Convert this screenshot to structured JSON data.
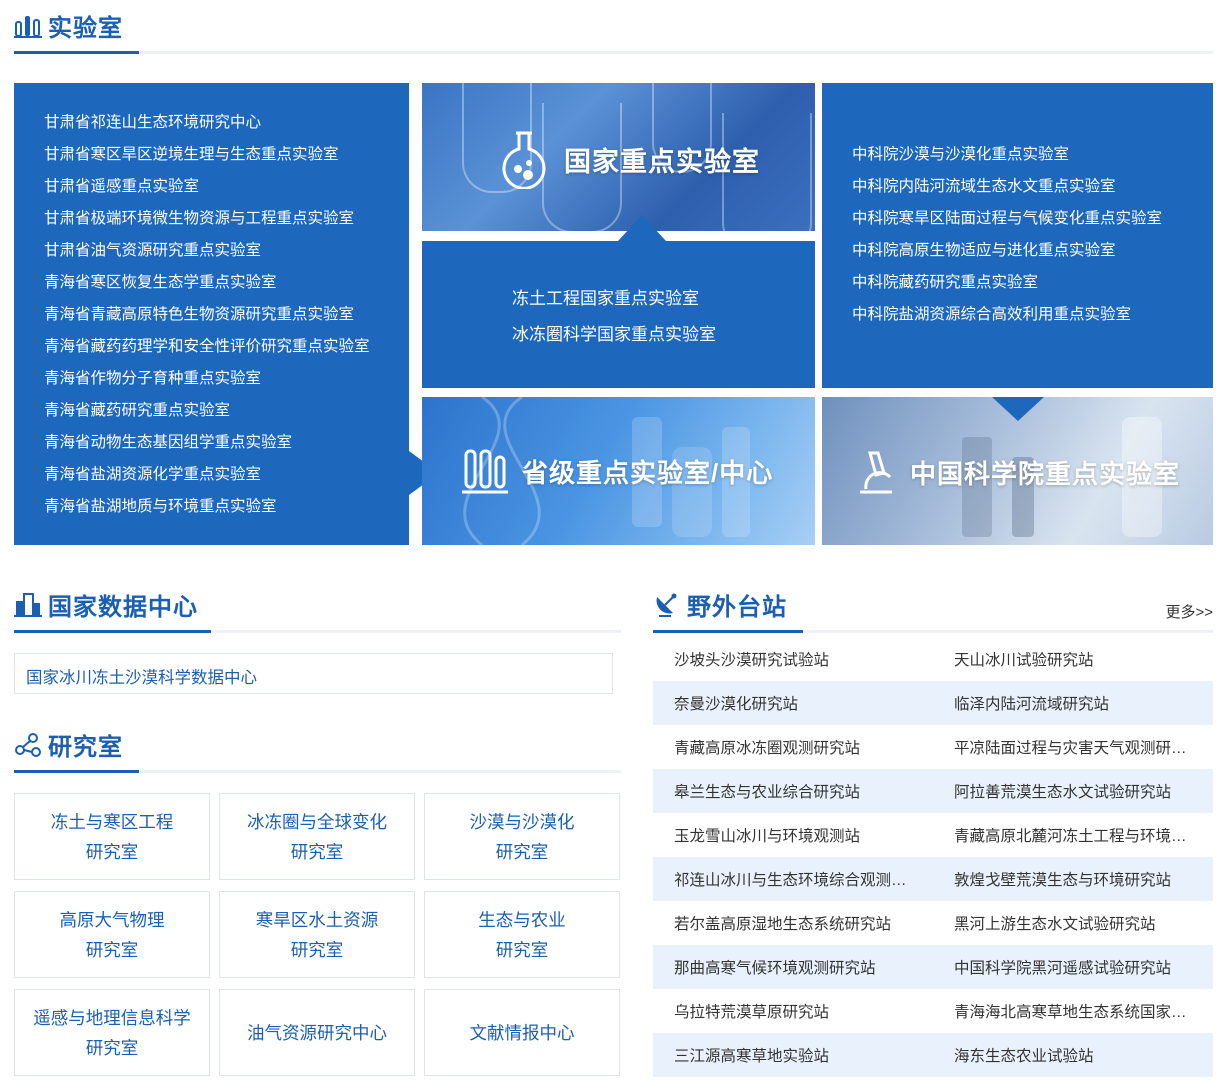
{
  "labs": {
    "title": "实验室",
    "provincial_list": [
      "甘肃省祁连山生态环境研究中心",
      "甘肃省寒区旱区逆境生理与生态重点实验室",
      "甘肃省遥感重点实验室",
      "甘肃省极端环境微生物资源与工程重点实验室",
      "甘肃省油气资源研究重点实验室",
      "青海省寒区恢复生态学重点实验室",
      "青海省青藏高原特色生物资源研究重点实验室",
      "青海省藏药药理学和安全性评价研究重点实验室",
      "青海省作物分子育种重点实验室",
      "青海省藏药研究重点实验室",
      "青海省动物生态基因组学重点实验室",
      "青海省盐湖资源化学重点实验室",
      "青海省盐湖地质与环境重点实验室"
    ],
    "national_title": "国家重点实验室",
    "national_list": [
      "冻土工程国家重点实验室",
      "冰冻圈科学国家重点实验室"
    ],
    "provincial_title": "省级重点实验室/中心",
    "cas_title": "中国科学院重点实验室",
    "cas_list": [
      "中科院沙漠与沙漠化重点实验室",
      "中科院内陆河流域生态水文重点实验室",
      "中科院寒旱区陆面过程与气候变化重点实验室",
      "中科院高原生物适应与进化重点实验室",
      "中科院藏药研究重点实验室",
      "中科院盐湖资源综合高效利用重点实验室"
    ]
  },
  "data_center": {
    "title": "国家数据中心",
    "item": "国家冰川冻土沙漠科学数据中心"
  },
  "research": {
    "title": "研究室",
    "cells": [
      "冻土与寒区工程\n研究室",
      "冰冻圈与全球变化\n研究室",
      "沙漠与沙漠化\n研究室",
      "高原大气物理\n研究室",
      "寒旱区水土资源\n研究室",
      "生态与农业\n研究室",
      "遥感与地理信息科学\n研究室",
      "油气资源研究中心",
      "文献情报中心"
    ]
  },
  "stations": {
    "title": "野外台站",
    "more": "更多>>",
    "rows": [
      [
        "沙坡头沙漠研究试验站",
        "天山冰川试验研究站"
      ],
      [
        "奈曼沙漠化研究站",
        "临泽内陆河流域研究站"
      ],
      [
        "青藏高原冰冻圈观测研究站",
        "平凉陆面过程与灾害天气观测研…"
      ],
      [
        "皋兰生态与农业综合研究站",
        "阿拉善荒漠生态水文试验研究站"
      ],
      [
        "玉龙雪山冰川与环境观测站",
        "青藏高原北麓河冻土工程与环境…"
      ],
      [
        "祁连山冰川与生态环境综合观测…",
        "敦煌戈壁荒漠生态与环境研究站"
      ],
      [
        "若尔盖高原湿地生态系统研究站",
        "黑河上游生态水文试验研究站"
      ],
      [
        "那曲高寒气候环境观测研究站",
        "中国科学院黑河遥感试验研究站"
      ],
      [
        "乌拉特荒漠草原研究站",
        "青海海北高寒草地生态系统国家…"
      ],
      [
        "三江源高寒草地实验站",
        "海东生态农业试验站"
      ]
    ]
  }
}
